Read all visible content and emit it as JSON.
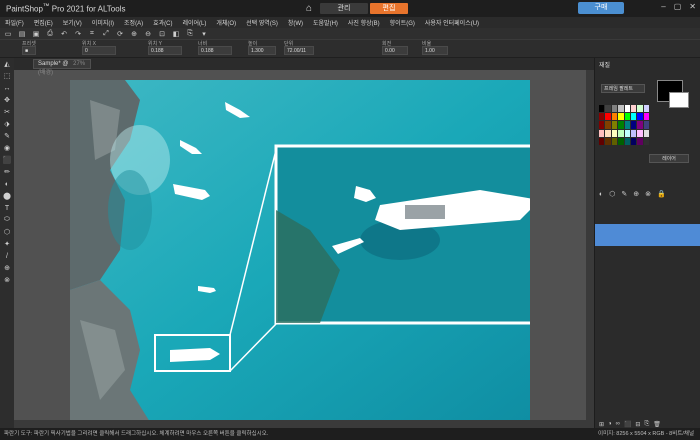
{
  "app": {
    "title_prefix": "PaintShop",
    "title_suffix": " Pro 2021 for ALTools",
    "mode_tabs": {
      "manage": "관리",
      "edit": "편집"
    },
    "buy_label": "구매",
    "win_ctrls": {
      "min": "–",
      "max": "▢",
      "close": "✕"
    }
  },
  "menu": [
    "파일(F)",
    "편집(E)",
    "보기(V)",
    "이미지(I)",
    "조정(A)",
    "효과(C)",
    "레이어(L)",
    "개체(O)",
    "선택 영역(S)",
    "창(W)",
    "도움말(H)",
    "사진 향상(B)",
    "향이트(G)",
    "사용자 인터페이스(U)"
  ],
  "toolbar_icons": [
    "new-file-icon",
    "open-icon",
    "save-icon",
    "print-icon",
    "undo-icon",
    "redo-icon",
    "crop-icon",
    "resize-icon",
    "rotate-icon",
    "zoom-in-icon",
    "zoom-out-icon",
    "fit-icon",
    "layers-icon",
    "copy-icon",
    "paste-icon"
  ],
  "options": {
    "labels": [
      "프리셋",
      "위치 X",
      "위치 Y",
      "너비",
      "높이",
      "단위",
      "회전",
      "비율"
    ],
    "values": [
      "■",
      "0",
      "0.188",
      "0.188",
      "1.300",
      "72.00/11",
      "0.00",
      "1.00"
    ]
  },
  "tools": [
    "◭",
    "⬚",
    "↔",
    "✥",
    "✂",
    "⬗",
    "✎",
    "◉",
    "⬛",
    "✏",
    "◐",
    "⬤",
    "T",
    "⬭",
    "⬡",
    "✦",
    "/",
    "⊕",
    "⊗"
  ],
  "document_tab": {
    "name": "Sample* @",
    "zoom": "27% (배경)"
  },
  "panel": {
    "title": "재질",
    "palette_select": "프레임 팔레트",
    "layers_button": "레이어",
    "layer_tools": [
      "◐",
      "⬡",
      "✎",
      "⊕",
      "⊗",
      "🔒"
    ],
    "bottom_tools": [
      "⊞",
      "◑",
      "∞",
      "⬛",
      "⊟",
      "⎘",
      "🗑"
    ]
  },
  "swatches": [
    "#000",
    "#404040",
    "#808080",
    "#c0c0c0",
    "#fff",
    "#ffd0d0",
    "#d0ffd0",
    "#d0d0ff",
    "#8b0000",
    "#ff0000",
    "#ff8000",
    "#ffff00",
    "#00ff00",
    "#00ffff",
    "#0000ff",
    "#ff00ff",
    "#800000",
    "#804000",
    "#808000",
    "#008000",
    "#008080",
    "#000080",
    "#800080",
    "#404080",
    "#ffc0c0",
    "#ffe0c0",
    "#ffffc0",
    "#c0ffc0",
    "#c0ffff",
    "#c0c0ff",
    "#ffc0ff",
    "#e0e0e0",
    "#600000",
    "#603000",
    "#606000",
    "#006000",
    "#006060",
    "#000060",
    "#600060",
    "#303030"
  ],
  "status": {
    "text": "파란기 도구: 파란기 픽사기법을 그리려면 클릭해서 드래그하십시오. 체계하려면 마우스 오른쪽 버튼을 클릭하십시오.",
    "info": "이미지: 8256 x 5504 x RGB - 8비트/채널"
  }
}
